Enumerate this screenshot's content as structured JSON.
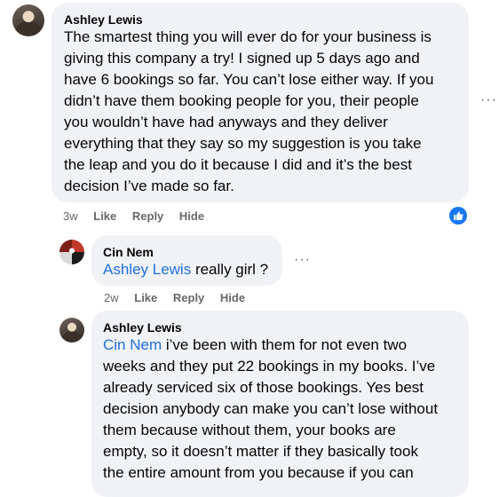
{
  "comment1": {
    "author": "Ashley Lewis",
    "lines": [
      "The smartest thing you will ever do for your business is",
      "giving this company a try! I signed up 5 days ago and",
      "have 6 bookings so far. You can’t lose either way. If you",
      "didn’t have them booking people for you, their people",
      "you wouldn’t have had anyways and they deliver",
      "everything that they say so my suggestion is you take",
      "the leap and you do it because I did and it’s the best",
      "decision I’ve made so far."
    ],
    "time": "3w",
    "like": "Like",
    "reply": "Reply",
    "hide": "Hide",
    "more": "···",
    "reaction_icon": "thumbs-up-icon",
    "reaction_color": "#1877f2"
  },
  "reply1": {
    "author": "Cin Nem",
    "mention": "Ashley Lewis",
    "text": " really girl ?",
    "time": "2w",
    "like": "Like",
    "reply": "Reply",
    "hide": "Hide",
    "more": "···"
  },
  "reply2": {
    "author": "Ashley Lewis",
    "mention": "Cin Nem",
    "first_line_rest": " i’ve been with them for not even two",
    "lines": [
      "weeks and they put 22 bookings in my books. I’ve",
      "already serviced six of those bookings. Yes best",
      "decision anybody can make you can’t lose without",
      "them because without them, your books are",
      "empty, so it doesn’t matter if they basically took",
      "the entire amount from you because if you can"
    ]
  },
  "colors": {
    "bubble": "#f0f2f5",
    "mention": "#216fdb",
    "meta": "#65676b"
  }
}
